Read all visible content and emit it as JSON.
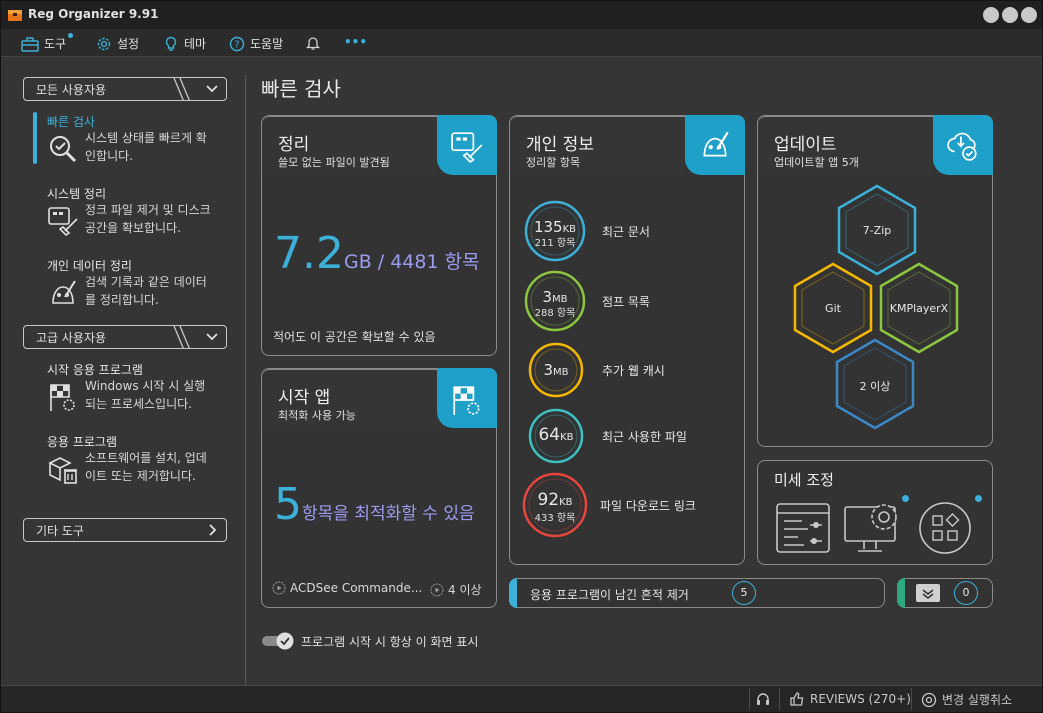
{
  "window": {
    "title": "Reg Organizer 9.91"
  },
  "menu": [
    {
      "label": "도구",
      "icon": "toolbox-icon"
    },
    {
      "label": "설정",
      "icon": "gear-icon"
    },
    {
      "label": "테마",
      "icon": "lightbulb-icon"
    },
    {
      "label": "도움말",
      "icon": "help-icon"
    },
    {
      "label": "",
      "icon": "bell-icon"
    },
    {
      "label": "•••",
      "icon": "more-icon"
    }
  ],
  "sidebar": {
    "section_basic": "모든 사용자용",
    "section_advanced": "고급 사용자용",
    "section_other": "기타 도구",
    "items": [
      {
        "label": "빠른 검사",
        "desc": "시스템 상태를 빠르게 확인합니다.",
        "icon": "magnifier-check-icon"
      },
      {
        "label": "시스템 정리",
        "desc": "정크 파일 제거 및 디스크 공간을 확보합니다.",
        "icon": "cleanup-brush-icon"
      },
      {
        "label": "개인 데이터 정리",
        "desc": "검색 기록과 같은 데이터를 정리합니다.",
        "icon": "privacy-broom-icon"
      },
      {
        "label": "시작 응용 프로그램",
        "desc": "Windows 시작 시 실행되는 프로세스입니다.",
        "icon": "startup-flag-icon"
      },
      {
        "label": "응용 프로그램",
        "desc": "소프트웨어를 설치, 업데이트 또는 제거합니다.",
        "icon": "box-trash-icon"
      }
    ]
  },
  "main": {
    "title": "빠른 검사",
    "cleanup": {
      "title": "정리",
      "subtitle": "쓸모 없는 파일이 발견됨",
      "big_value": "7.2",
      "big_rest": "GB / 4481 항목",
      "footer": "적어도 이 공간은 확보할 수 있음"
    },
    "startup": {
      "title": "시작 앱",
      "subtitle": "최적화 사용 가능",
      "big_value": "5",
      "big_rest": "항목을 최적화할 수 있음",
      "app_name": "ACDSee Commande...",
      "more": "4 이상"
    },
    "privacy": {
      "title": "개인 정보",
      "subtitle": "정리할 항목",
      "rows": [
        {
          "num": "135",
          "unit": "KB",
          "count": "211 항목",
          "label": "최근 문서",
          "color": "#3cb0d8"
        },
        {
          "num": "3",
          "unit": "MB",
          "count": "288 항목",
          "label": "점프 목록",
          "color": "#8cc63f"
        },
        {
          "num": "3",
          "unit": "MB",
          "count": "",
          "label": "추가 웹 캐시",
          "color": "#f5b800"
        },
        {
          "num": "64",
          "unit": "KB",
          "count": "",
          "label": "최근 사용한 파일",
          "color": "#3cbfc0"
        },
        {
          "num": "92",
          "unit": "KB",
          "count": "433 항목",
          "label": "파일 다운로드 링크",
          "color": "#e8453c"
        }
      ]
    },
    "updates": {
      "title": "업데이트",
      "subtitle": "업데이트할 앱 5개",
      "apps": [
        "7-Zip",
        "Git",
        "KMPlayerX",
        "2 이상"
      ]
    },
    "tweaks": {
      "title": "미세 조정"
    },
    "traces": {
      "label": "응용 프로그램이 남긴 흔적 제거",
      "count": "5"
    },
    "drivers": {
      "count": "0"
    },
    "show_on_start": "프로그램 시작 시 항상 이 화면 표시"
  },
  "status": {
    "reviews": "REVIEWS (270+)",
    "undo": "변경 실행취소"
  },
  "colors": {
    "accent": "#3cb0d8",
    "green": "#8cc63f",
    "yellow": "#f5b800",
    "red": "#e8453c"
  }
}
